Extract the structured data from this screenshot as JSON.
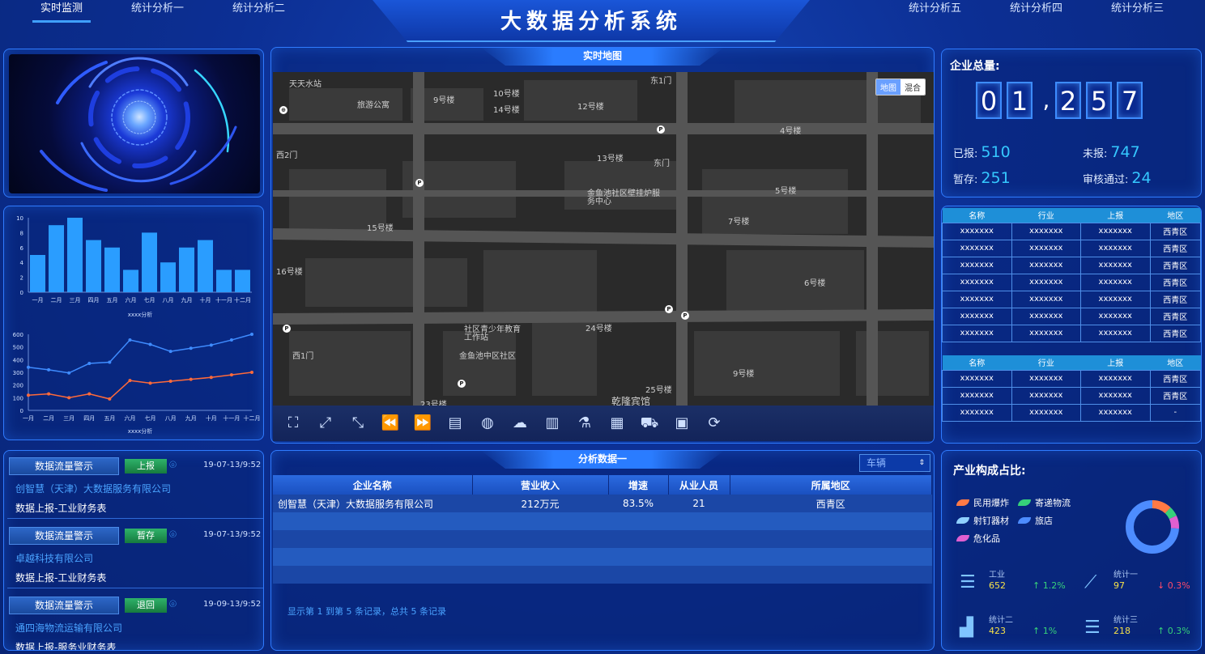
{
  "header": {
    "title": "大数据分析系统",
    "nav_left": [
      "实时监测",
      "统计分析一",
      "统计分析二"
    ],
    "nav_right": [
      "统计分析五",
      "统计分析四",
      "统计分析三"
    ]
  },
  "map_panel": {
    "title": "实时地图",
    "toggle": [
      "地图",
      "混合"
    ],
    "labels": [
      "天天水站",
      "旅游公寓",
      "9号楼",
      "10号楼",
      "14号楼",
      "12号楼",
      "东1门",
      "4号楼",
      "西2门",
      "13号楼",
      "东门",
      "金鱼池社区壁挂炉服务中心",
      "5号楼",
      "15号楼",
      "7号楼",
      "16号楼",
      "6号楼",
      "社区青少年教育工作站",
      "24号楼",
      "金鱼池中区社区",
      "西1门",
      "9号楼",
      "25号楼",
      "23号楼",
      "乾隆宾馆"
    ]
  },
  "enterprise": {
    "title": "企业总量:",
    "digits": [
      "0",
      "1",
      ",",
      "2",
      "5",
      "7"
    ],
    "reported_label": "已报:",
    "reported": "510",
    "unreported_label": "未报:",
    "unreported": "747",
    "pending_label": "暂存:",
    "pending": "251",
    "approved_label": "审核通过:",
    "approved": "24"
  },
  "table1": {
    "headers": [
      "名称",
      "行业",
      "上报",
      "地区"
    ],
    "rows": [
      [
        "xxxxxxx",
        "xxxxxxx",
        "xxxxxxx",
        "西青区"
      ],
      [
        "xxxxxxx",
        "xxxxxxx",
        "xxxxxxx",
        "西青区"
      ],
      [
        "xxxxxxx",
        "xxxxxxx",
        "xxxxxxx",
        "西青区"
      ],
      [
        "xxxxxxx",
        "xxxxxxx",
        "xxxxxxx",
        "西青区"
      ],
      [
        "xxxxxxx",
        "xxxxxxx",
        "xxxxxxx",
        "西青区"
      ],
      [
        "xxxxxxx",
        "xxxxxxx",
        "xxxxxxx",
        "西青区"
      ],
      [
        "xxxxxxx",
        "xxxxxxx",
        "xxxxxxx",
        "西青区"
      ]
    ]
  },
  "table2": {
    "headers": [
      "名称",
      "行业",
      "上报",
      "地区"
    ],
    "rows": [
      [
        "xxxxxxx",
        "xxxxxxx",
        "xxxxxxx",
        "西青区"
      ],
      [
        "xxxxxxx",
        "xxxxxxx",
        "xxxxxxx",
        "西青区"
      ],
      [
        "xxxxxxx",
        "xxxxxxx",
        "xxxxxxx",
        "-"
      ]
    ]
  },
  "alerts": [
    {
      "tag": "数据流量警示",
      "badge": "上报",
      "date": "19-07-13/9:52",
      "company": "创智慧（天津）大数据服务有限公司",
      "detail": "数据上报-工业财务表"
    },
    {
      "tag": "数据流量警示",
      "badge": "暂存",
      "date": "19-07-13/9:52",
      "company": "卓越科技有限公司",
      "detail": "数据上报-工业财务表"
    },
    {
      "tag": "数据流量警示",
      "badge": "退回",
      "date": "19-09-13/9:52",
      "company": "通四海物流运输有限公司",
      "detail": "数据上报-服务业财务表"
    }
  ],
  "analysis": {
    "title": "分析数据一",
    "select_value": "车辆",
    "headers": [
      "企业名称",
      "营业收入",
      "增速",
      "从业人员",
      "所属地区"
    ],
    "rows": [
      [
        "创智慧（天津）大数据服务有限公司",
        "212万元",
        "83.5%",
        "21",
        "西青区"
      ]
    ],
    "footer": "显示第 1 到第 5 条记录，总共 5 条记录"
  },
  "industry": {
    "title": "产业构成占比:",
    "legend": [
      {
        "name": "民用爆炸",
        "color": "#ff7a45"
      },
      {
        "name": "寄递物流",
        "color": "#36d17a"
      },
      {
        "name": "射钉器材",
        "color": "#8fd0ff"
      },
      {
        "name": "旅店",
        "color": "#4d8cff"
      },
      {
        "name": "危化品",
        "color": "#e05fd0"
      }
    ],
    "stats": [
      {
        "label": "工业",
        "value": "652",
        "trend": "↑ 1.2%",
        "up": true,
        "icon": "layers-icon"
      },
      {
        "label": "统计一",
        "value": "97",
        "trend": "↓ 0.3%",
        "up": false,
        "icon": "network-icon"
      },
      {
        "label": "统计二",
        "value": "423",
        "trend": "↑ 1%",
        "up": true,
        "icon": "bar-trend-icon"
      },
      {
        "label": "统计三",
        "value": "218",
        "trend": "↑ 0.3%",
        "up": true,
        "icon": "layers-icon"
      }
    ]
  },
  "chart_data": [
    {
      "type": "bar",
      "title": "",
      "xlabel": "xxxx分析",
      "categories": [
        "一月",
        "二月",
        "三月",
        "四月",
        "五月",
        "六月",
        "七月",
        "八月",
        "九月",
        "十月",
        "十一月",
        "十二月"
      ],
      "values": [
        5,
        9,
        10,
        7,
        6,
        3,
        8,
        4,
        6,
        7,
        3,
        3
      ],
      "ylim": [
        0,
        10
      ],
      "yticks": [
        0,
        2,
        4,
        6,
        8,
        10
      ]
    },
    {
      "type": "line",
      "title": "",
      "xlabel": "xxxx分析",
      "categories": [
        "一月",
        "二月",
        "三月",
        "四月",
        "五月",
        "六月",
        "七月",
        "八月",
        "九月",
        "十月",
        "十一月",
        "十二月"
      ],
      "series": [
        {
          "values": [
            340,
            320,
            295,
            370,
            380,
            555,
            520,
            465,
            490,
            515,
            555,
            600
          ],
          "color": "#3f8cff"
        },
        {
          "values": [
            120,
            130,
            100,
            130,
            90,
            235,
            215,
            230,
            245,
            260,
            280,
            300
          ],
          "color": "#ff6a3a"
        }
      ],
      "ylim": [
        0,
        600
      ],
      "yticks": [
        0,
        100,
        200,
        300,
        400,
        500,
        600
      ]
    },
    {
      "type": "pie",
      "title": "",
      "categories": [
        "民用爆炸",
        "寄递物流",
        "危化品",
        "旅店"
      ],
      "values": [
        12,
        6,
        8,
        74
      ]
    }
  ]
}
